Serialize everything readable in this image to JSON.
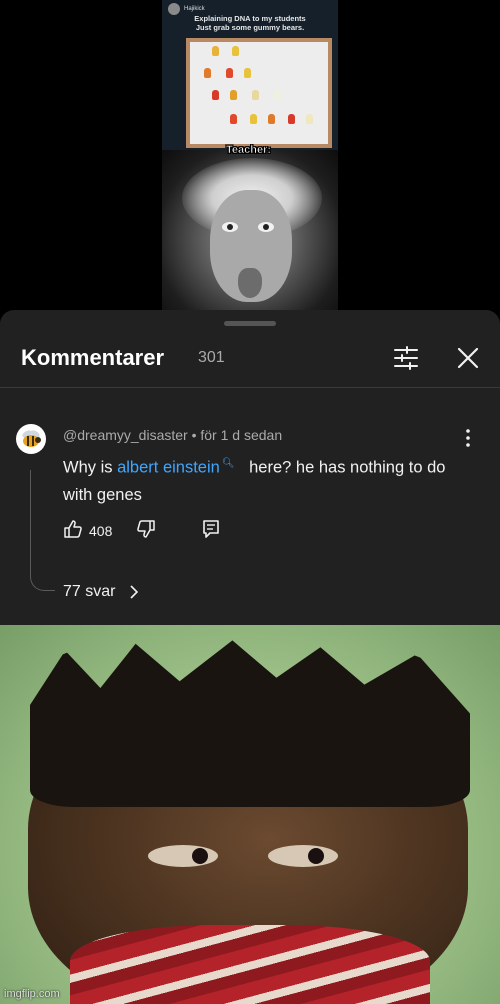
{
  "video": {
    "tweet_user": "Hajikick",
    "tweet_text_line1": "Explaining DNA to my students",
    "tweet_text_line2": "Just grab some gummy bears.",
    "caption": "Teacher:"
  },
  "comments": {
    "title": "Kommentarer",
    "count": "301",
    "comment": {
      "author": "@dreamyy_disaster",
      "time": "• för 1 d sedan",
      "text_before": "Why is ",
      "link_text": "albert einstein",
      "text_after": " here? he has nothing to do with genes",
      "likes": "408",
      "replies": "77 svar"
    }
  },
  "watermark": "imgflip.com",
  "colors": {
    "panel_bg": "#212121",
    "link": "#3ea6ff",
    "text": "#f1f1f1",
    "muted": "#aaaaaa"
  },
  "icons": [
    "filter-icon",
    "close-icon",
    "kebab-menu-icon",
    "thumbs-up-icon",
    "thumbs-down-icon",
    "reply-icon",
    "chevron-right-icon",
    "search-icon",
    "bee-avatar-icon"
  ]
}
